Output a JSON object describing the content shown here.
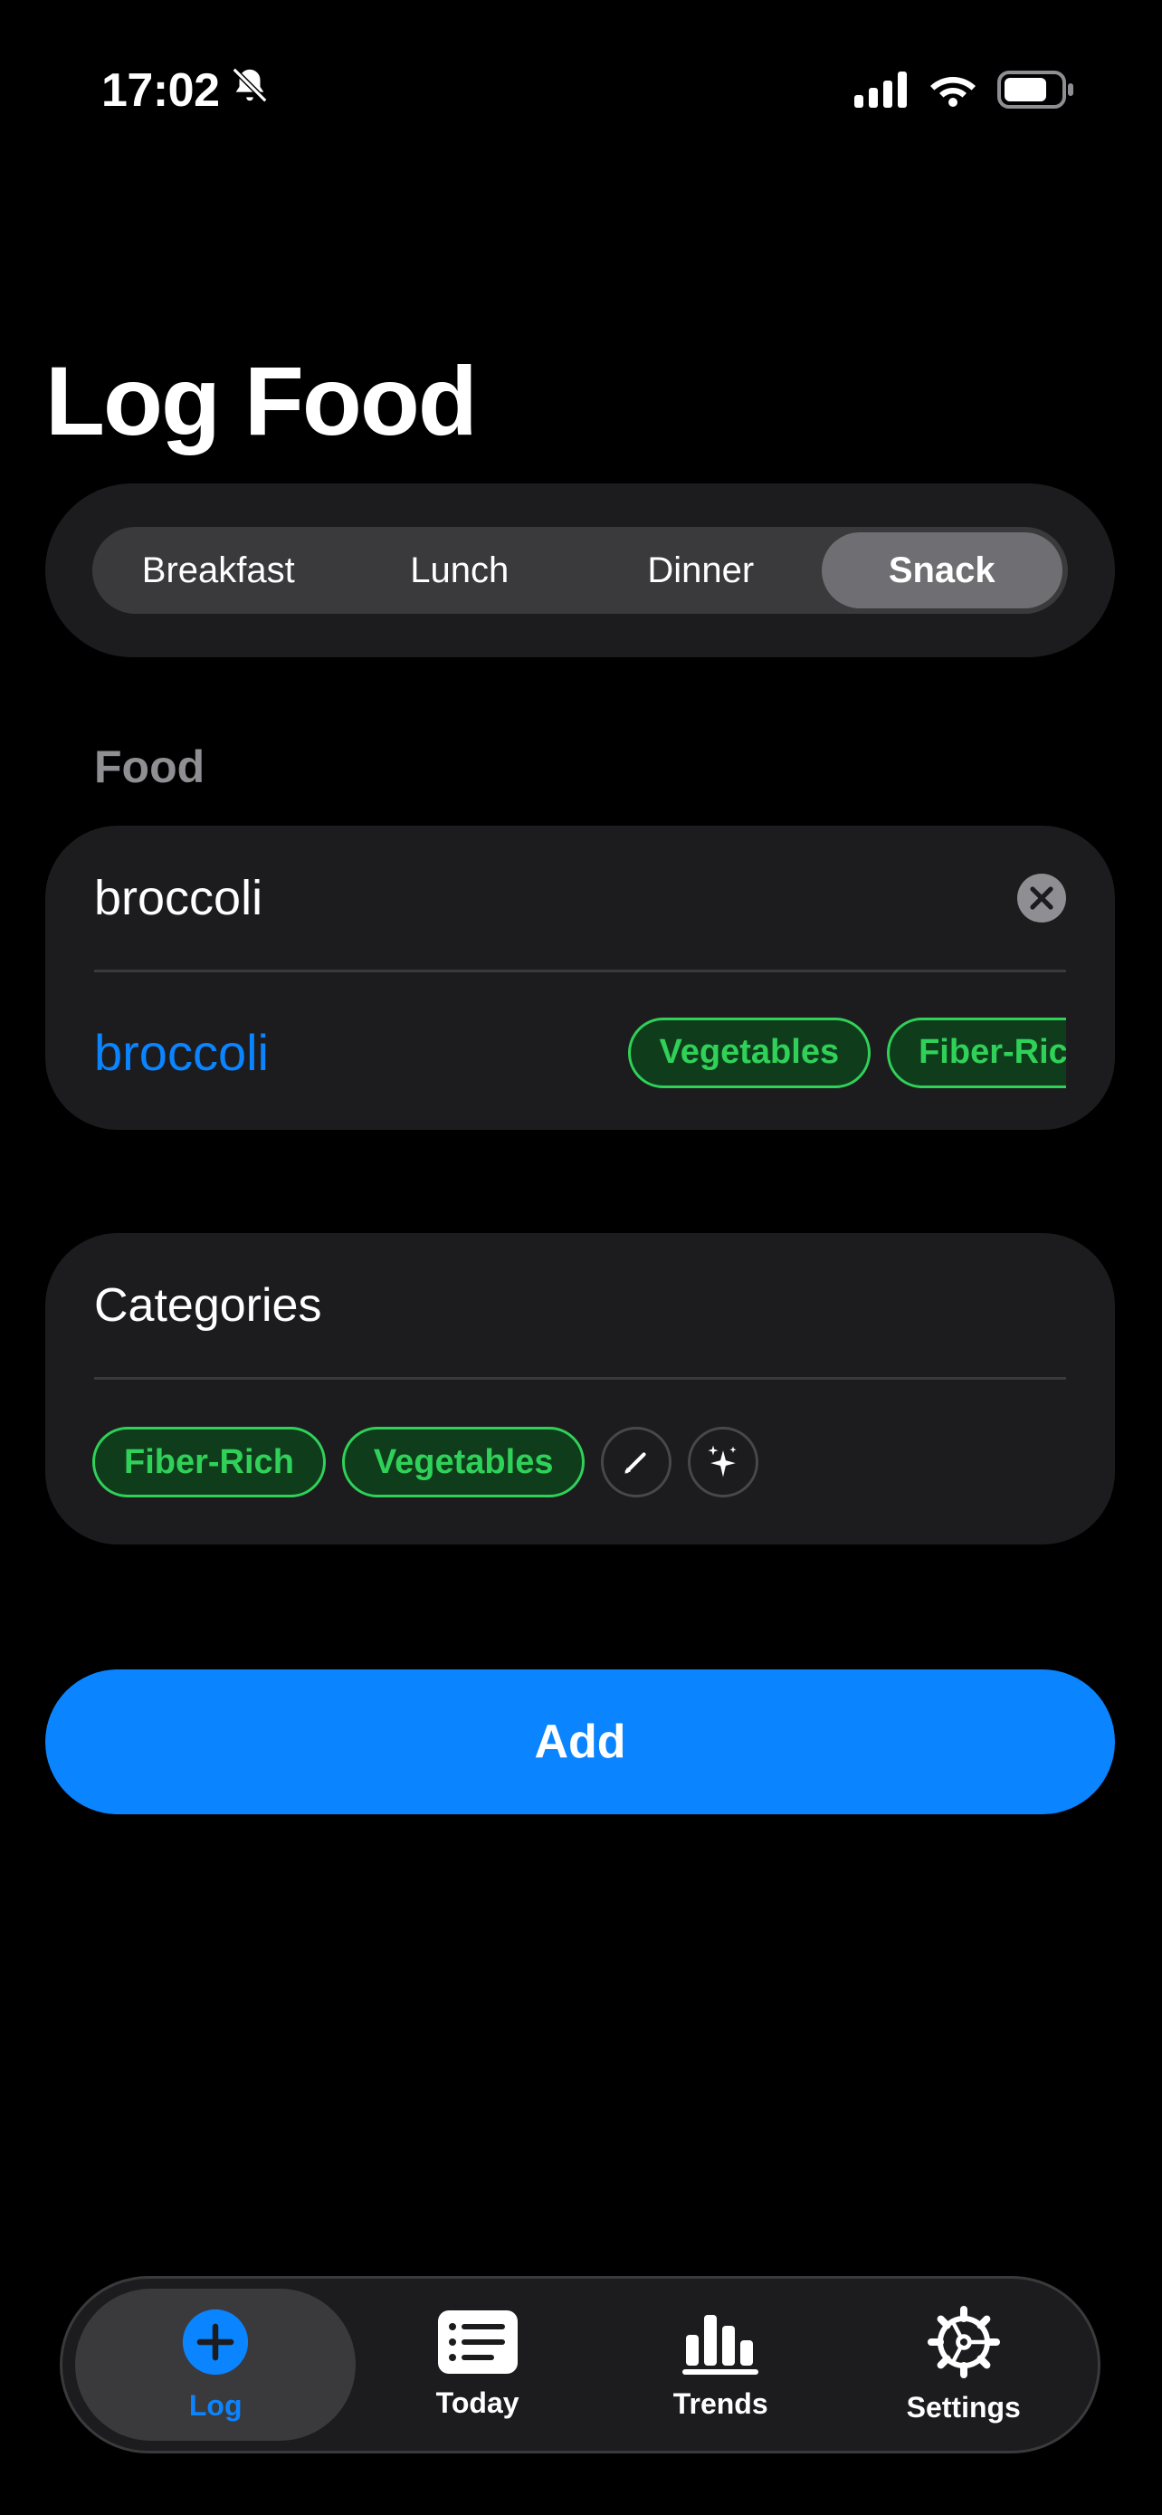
{
  "status": {
    "time": "17:02"
  },
  "header": {
    "title": "Log Food"
  },
  "meal_segments": {
    "items": [
      "Breakfast",
      "Lunch",
      "Dinner",
      "Snack"
    ],
    "selected": "Snack"
  },
  "food": {
    "label": "Food",
    "input_value": "broccoli",
    "suggestion": {
      "name": "broccoli",
      "tags": [
        "Vegetables",
        "Fiber-Rich"
      ]
    }
  },
  "categories": {
    "title": "Categories",
    "tags": [
      "Fiber-Rich",
      "Vegetables"
    ]
  },
  "actions": {
    "add_label": "Add"
  },
  "tabbar": {
    "tabs": [
      {
        "label": "Log",
        "icon": "plus-circle-icon",
        "active": true
      },
      {
        "label": "Today",
        "icon": "list-icon",
        "active": false
      },
      {
        "label": "Trends",
        "icon": "chart-bars-icon",
        "active": false
      },
      {
        "label": "Settings",
        "icon": "gear-icon",
        "active": false
      }
    ]
  },
  "colors": {
    "accent": "#0a84ff",
    "tag_green": "#30d158",
    "card": "#1c1c1e"
  }
}
